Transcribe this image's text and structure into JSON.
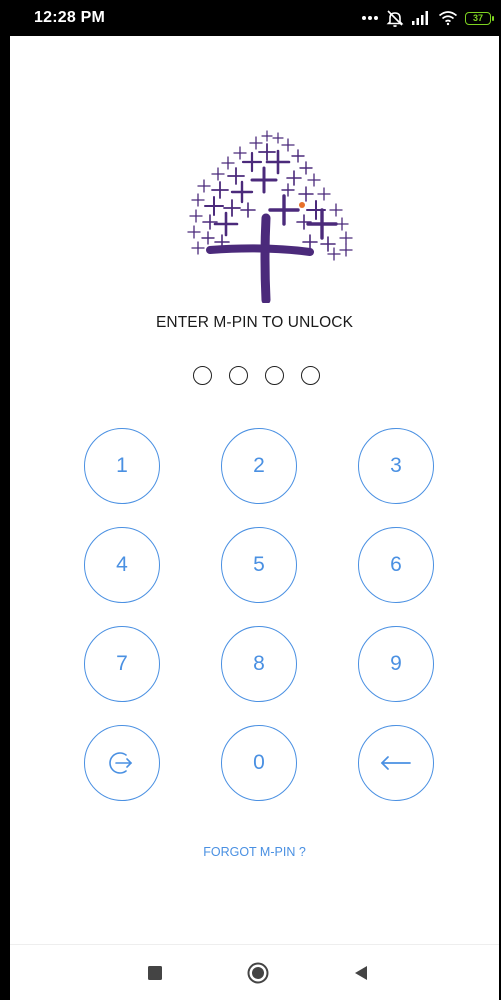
{
  "status_bar": {
    "time": "12:28 PM",
    "battery_level": "37",
    "icons": [
      "more-dots-icon",
      "alarm-off-icon",
      "signal-icon",
      "wifi-icon",
      "battery-icon"
    ]
  },
  "logo": {
    "icon": "cross-tree-logo",
    "colors": {
      "primary": "#4b2a7b",
      "accent": "#e8702a"
    }
  },
  "prompt": "ENTER M-PIN TO UNLOCK",
  "pin": {
    "length": 4,
    "filled": 0
  },
  "keypad": {
    "keys": [
      "1",
      "2",
      "3",
      "4",
      "5",
      "6",
      "7",
      "8",
      "9",
      "0"
    ],
    "logout_icon": "logout-icon",
    "backspace_icon": "backspace-arrow-icon"
  },
  "forgot_link": "FORGOT M-PIN ?",
  "nav_bar": {
    "icons": [
      "recents-square-icon",
      "home-circle-icon",
      "back-triangle-icon"
    ]
  },
  "colors": {
    "accent": "#4a90e2",
    "battery": "#7ed321",
    "status_bar": "#000000"
  }
}
